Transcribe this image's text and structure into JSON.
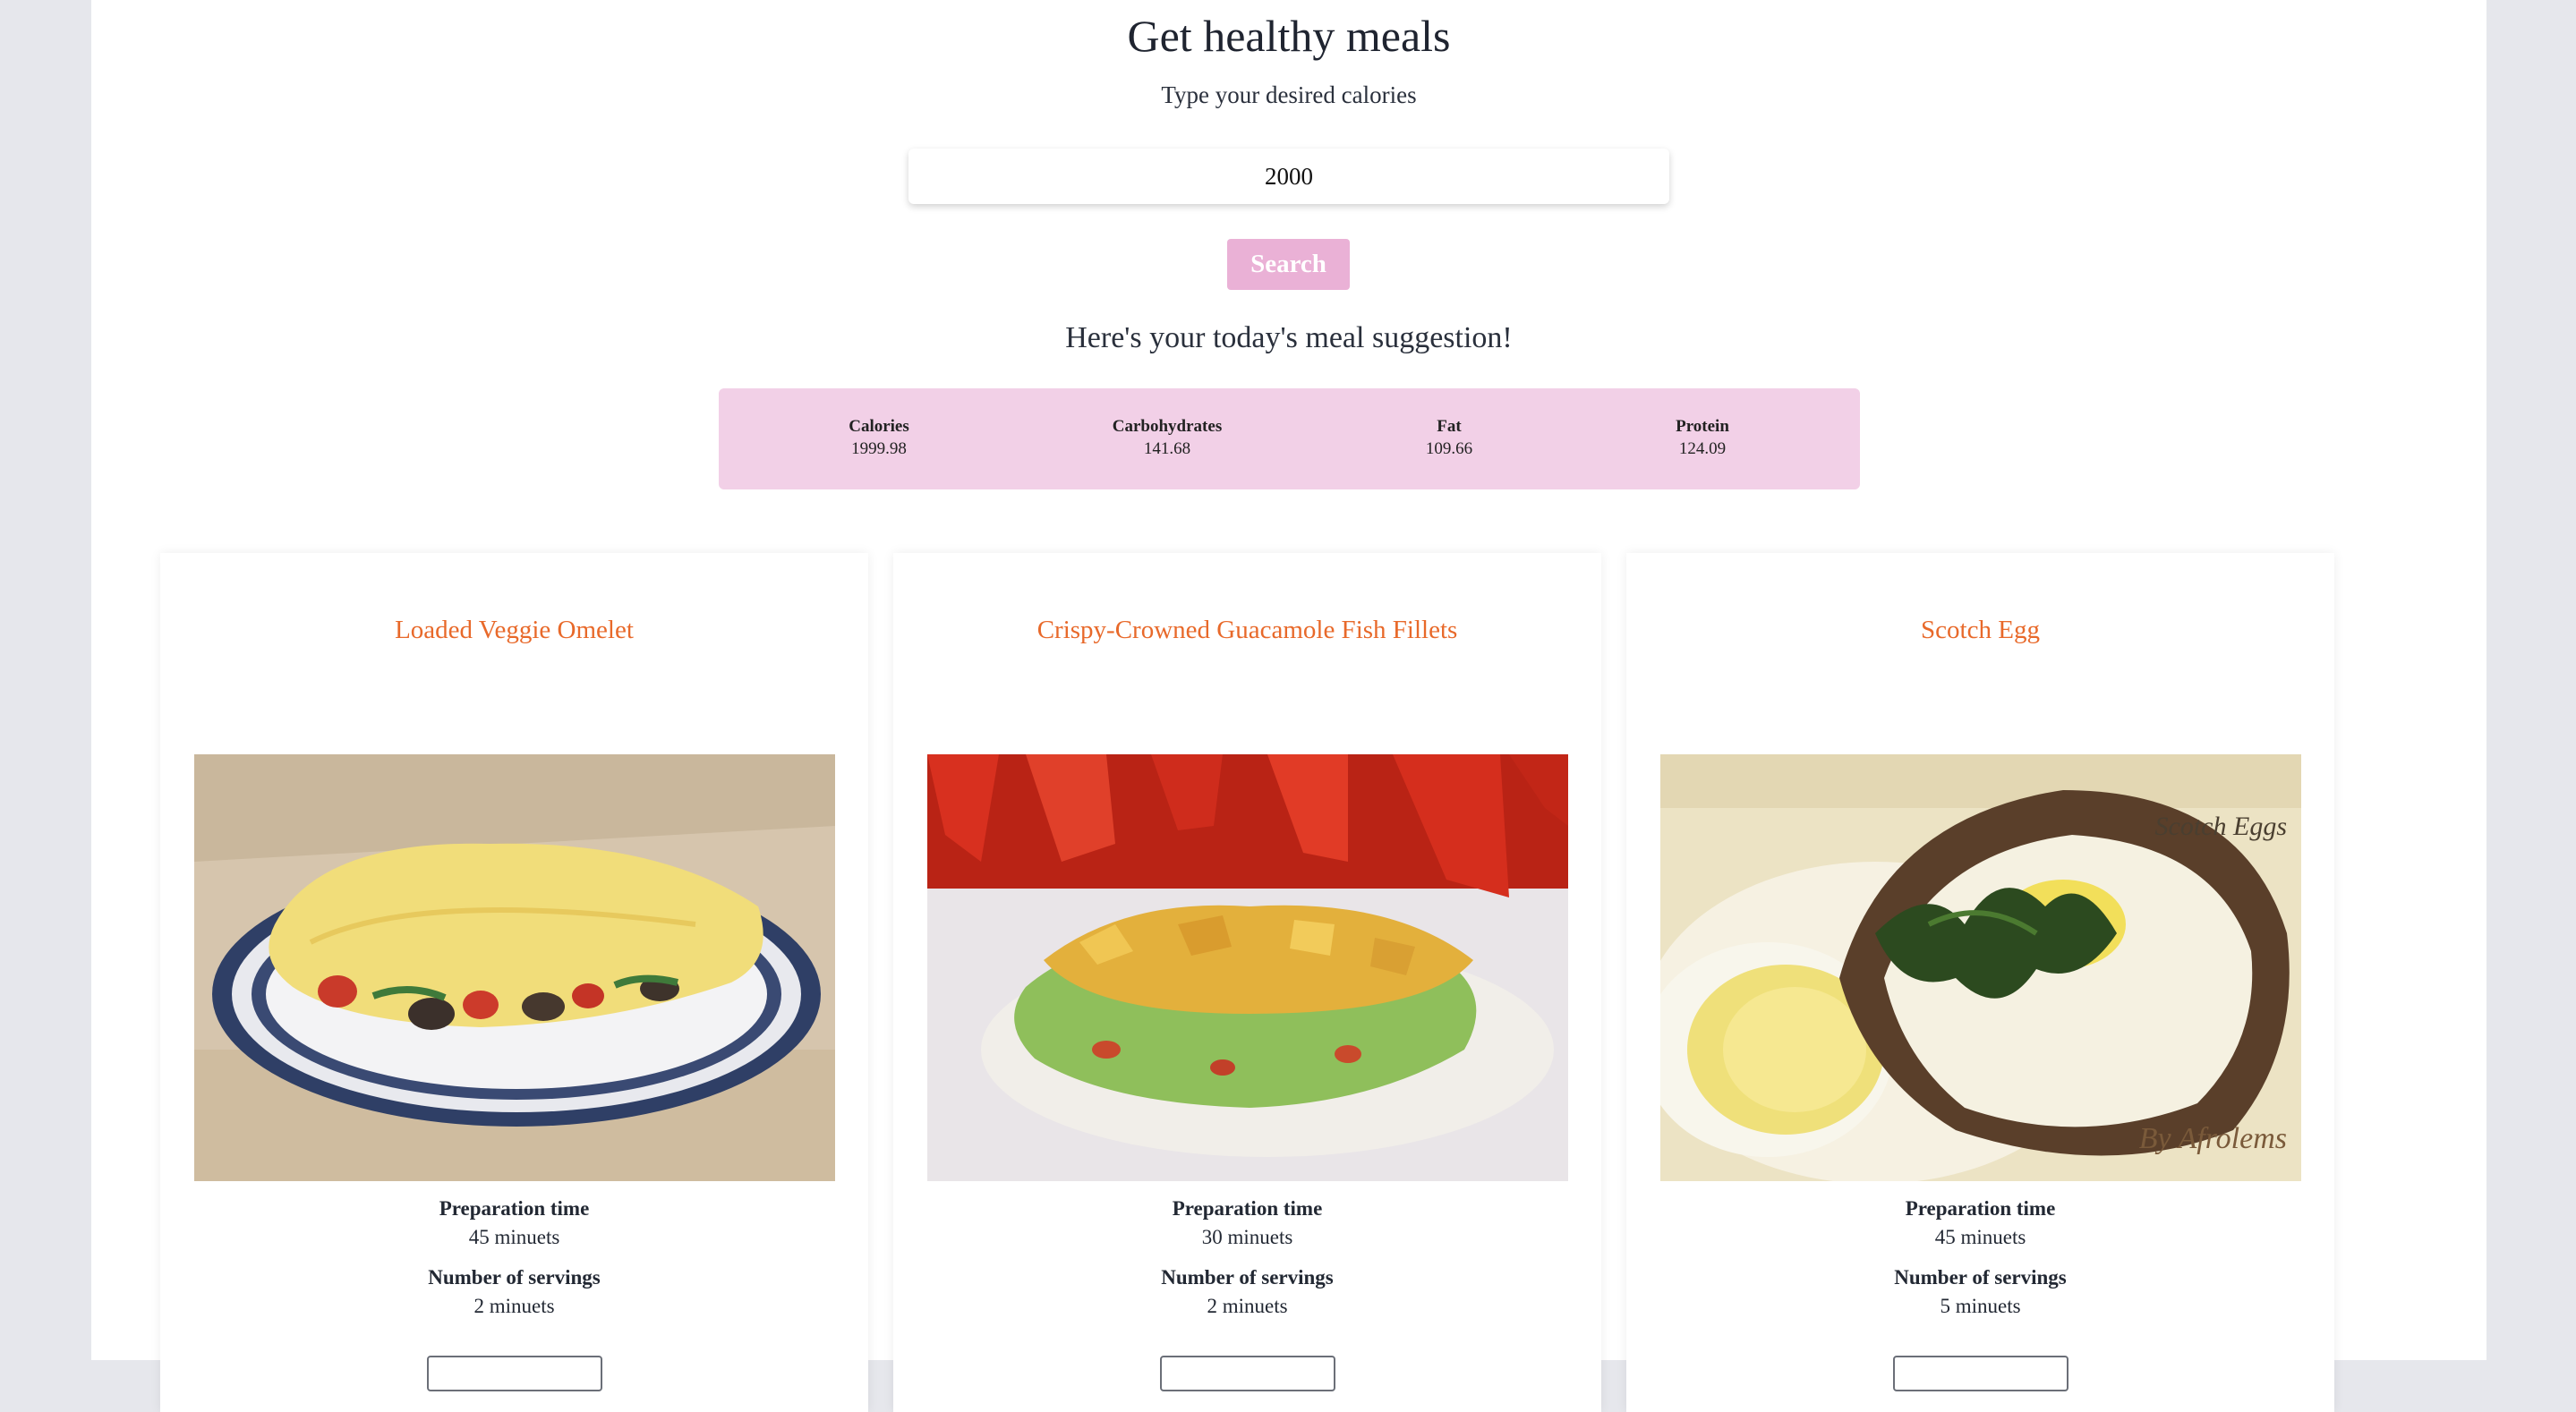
{
  "header": {
    "title": "Get healthy meals",
    "subtitle": "Type your desired calories"
  },
  "search": {
    "value": "2000",
    "button_label": "Search"
  },
  "suggestion_heading": "Here's your today's meal suggestion!",
  "nutrients": [
    {
      "label": "Calories",
      "value": "1999.98"
    },
    {
      "label": "Carbohydrates",
      "value": "141.68"
    },
    {
      "label": "Fat",
      "value": "109.66"
    },
    {
      "label": "Protein",
      "value": "124.09"
    }
  ],
  "meals": [
    {
      "title": "Loaded Veggie Omelet",
      "prep_label": "Preparation time",
      "prep_value": "45 minuets",
      "servings_label": "Number of servings",
      "servings_value": "2 minuets"
    },
    {
      "title": "Crispy-Crowned Guacamole Fish Fillets",
      "prep_label": "Preparation time",
      "prep_value": "30 minuets",
      "servings_label": "Number of servings",
      "servings_value": "2 minuets"
    },
    {
      "title": "Scotch Egg",
      "prep_label": "Preparation time",
      "prep_value": "45 minuets",
      "servings_label": "Number of servings",
      "servings_value": "5 minuets",
      "image_overlay_text": [
        "Scotch Eggs",
        "By Afrolems"
      ]
    }
  ],
  "colors": {
    "accent_pink": "#eab1d6",
    "nutrient_box": "#f2d0e7",
    "meal_title": "#e8692a"
  }
}
